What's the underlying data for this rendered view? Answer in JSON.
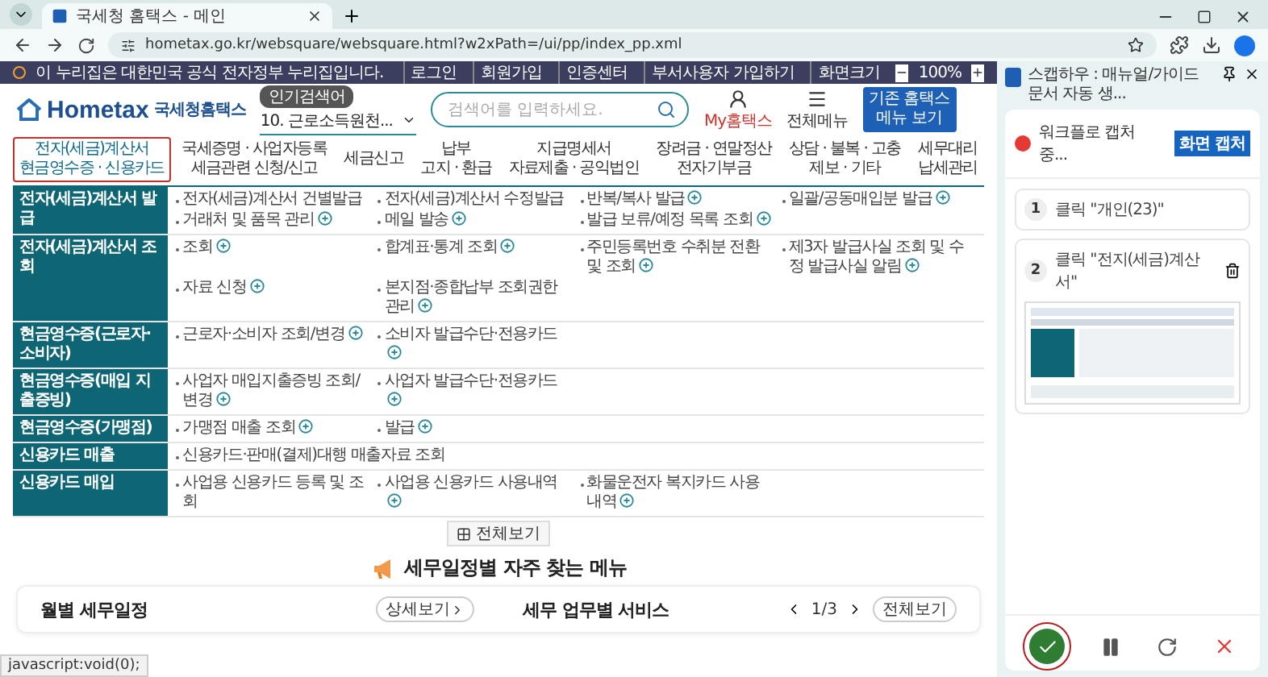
{
  "browser": {
    "tab_title": "국세청 홈택스 - 메인",
    "url": "hometax.go.kr/websquare/websquare.html?w2xPath=/ui/pp/index_pp.xml"
  },
  "gov_banner": {
    "text": "이 누리집은 대한민국 공식 전자정부 누리집입니다.",
    "links": [
      "로그인",
      "회원가입",
      "인증센터",
      "부서사용자 가입하기"
    ],
    "zoom_label": "화면크기",
    "zoom": "100%"
  },
  "header": {
    "logo": "Hometax",
    "logo_sub": "국세청홈택스",
    "popular_badge": "인기검색어",
    "popular_term": "10. 근로소득원천...",
    "search_placeholder": "검색어를 입력하세요.",
    "my": "My홈택스",
    "all_menu": "전체메뉴",
    "legacy_button": "기존 홈택스 메뉴 보기"
  },
  "nav": [
    {
      "lines": [
        "전자(세금)계산서",
        "현금영수증 · 신용카드"
      ],
      "selected": true
    },
    {
      "lines": [
        "국세증명 · 사업자등록",
        "세금관련 신청/신고"
      ],
      "selected": false
    },
    {
      "lines": [
        "세금신고"
      ],
      "selected": false
    },
    {
      "lines": [
        "납부",
        "고지 · 환급"
      ],
      "selected": false
    },
    {
      "lines": [
        "지급명세서",
        "자료제출 · 공익법인"
      ],
      "selected": false
    },
    {
      "lines": [
        "장려금 · 연말정산",
        "전자기부금"
      ],
      "selected": false
    },
    {
      "lines": [
        "상담 · 불복 · 고충",
        "제보 · 기타"
      ],
      "selected": false
    },
    {
      "lines": [
        "세무대리",
        "납세관리"
      ],
      "selected": false
    }
  ],
  "menu": [
    {
      "title": "전자(세금)계산서 발급",
      "items": [
        {
          "text": "전자(세금)계산서 건별발급",
          "expandable": false
        },
        {
          "text": "전자(세금)계산서 수정발급",
          "expandable": false
        },
        {
          "text": "반복/복사 발급",
          "expandable": true
        },
        {
          "text": "일괄/공동매입분 발급",
          "expandable": true
        },
        {
          "text": "거래처 및 품목 관리",
          "expandable": true
        },
        {
          "text": "메일 발송",
          "expandable": true
        },
        {
          "text": "발급 보류/예정 목록 조회",
          "expandable": true
        }
      ]
    },
    {
      "title": "전자(세금)계산서 조회",
      "items": [
        {
          "text": "조회",
          "expandable": true
        },
        {
          "text": "합계표·통계 조회",
          "expandable": true
        },
        {
          "text": "주민등록번호 수취분 전환 및 조회",
          "expandable": true
        },
        {
          "text": "제3자 발급사실 조회 및 수정 발급사실 알림",
          "expandable": true
        },
        {
          "text": "자료 신청",
          "expandable": true
        },
        {
          "text": "본지점·종합납부 조회권한 관리",
          "expandable": true
        }
      ]
    },
    {
      "title": "현금영수증(근로자·소비자)",
      "items": [
        {
          "text": "근로자·소비자 조회/변경",
          "expandable": true
        },
        {
          "text": "소비자 발급수단·전용카드",
          "expandable": true
        }
      ]
    },
    {
      "title": "현금영수증(매입 지출증빙)",
      "items": [
        {
          "text": "사업자 매입지출증빙 조회/변경",
          "expandable": true
        },
        {
          "text": "사업자 발급수단·전용카드",
          "expandable": true
        }
      ]
    },
    {
      "title": "현금영수증(가맹점)",
      "items": [
        {
          "text": "가맹점 매출 조회",
          "expandable": true
        },
        {
          "text": "발급",
          "expandable": true
        }
      ]
    },
    {
      "title": "신용카드 매출",
      "items": [
        {
          "text": "신용카드·판매(결제)대행 매출자료 조회",
          "expandable": false,
          "wide": true
        }
      ]
    },
    {
      "title": "신용카드 매입",
      "items": [
        {
          "text": "사업용 신용카드 등록 및 조회",
          "expandable": false
        },
        {
          "text": "사업용 신용카드 사용내역",
          "expandable": true
        },
        {
          "text": "화물운전자 복지카드 사용내역",
          "expandable": true
        }
      ]
    }
  ],
  "view_all": "전체보기",
  "section_heading": "세무일정별 자주 찾는 메뉴",
  "schedule": {
    "title": "월별 세무일정",
    "detail_button": "상세보기"
  },
  "services": {
    "title": "세무 업무별 서비스",
    "page": "1/3",
    "view_all": "전체보기"
  },
  "status_url": "javascript:void(0);",
  "side_panel": {
    "title": "스캡하우 : 매뉴얼/가이드 문서 자동 생...",
    "recording": true,
    "status": "워크플로 캡처 중...",
    "capture_button": "화면 캡처",
    "steps": [
      {
        "number": "1",
        "text": "클릭 \"개인(23)\"",
        "has_screenshot": false
      },
      {
        "number": "2",
        "text": "클릭 \"전지(세금)계산서\"",
        "has_screenshot": true
      }
    ]
  }
}
